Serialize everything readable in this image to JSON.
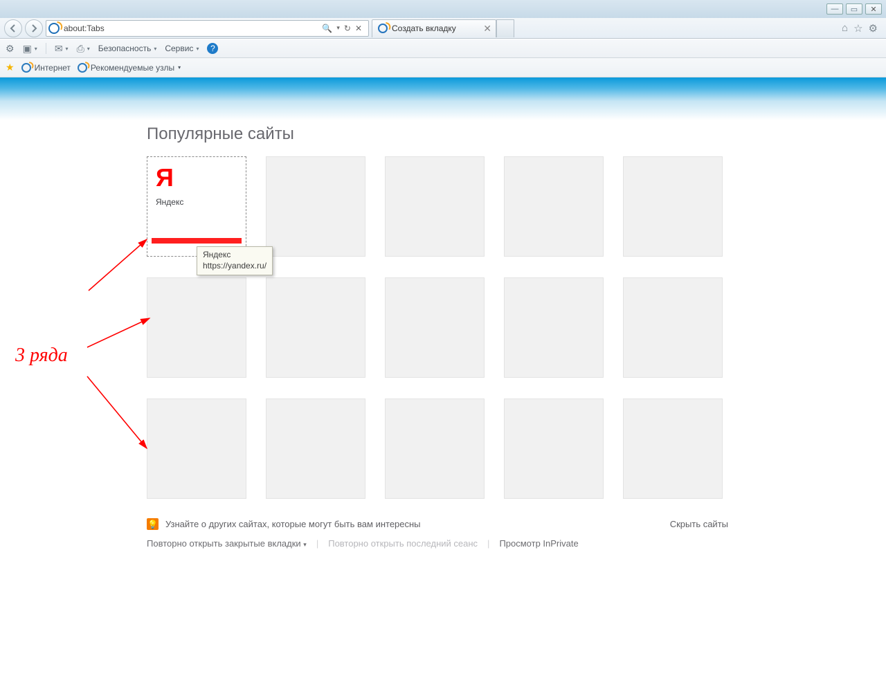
{
  "os": {
    "min_icon": "—",
    "max_icon": "▭",
    "close_icon": "✕"
  },
  "nav": {
    "url": "about:Tabs",
    "search_icon": "🔍",
    "refresh_icon": "↻",
    "stop_icon": "✕"
  },
  "tab": {
    "title": "Создать вкладку",
    "close": "✕"
  },
  "right": {
    "home": "⌂",
    "star": "☆",
    "gear": "⚙"
  },
  "cmdbar": {
    "tools": "⚙",
    "rss": "▣",
    "mail": "✉",
    "print": "⎙",
    "safety": "Безопасность",
    "service": "Сервис",
    "help": "?"
  },
  "favbar": {
    "star": "★",
    "internet": "Интернет",
    "recommended": "Рекомендуемые узлы"
  },
  "page": {
    "heading": "Популярные сайты",
    "tile1": {
      "letter": "Я",
      "name": "Яндекс"
    },
    "tooltip": {
      "title": "Яндекс",
      "url": "https://yandex.ru/"
    },
    "suggest": "Узнайте о других сайтах, которые могут быть вам интересны",
    "hide": "Скрыть сайты",
    "reopen_closed": "Повторно открыть закрытые вкладки",
    "reopen_last": "Повторно открыть последний сеанс",
    "inprivate": "Просмотр InPrivate"
  },
  "anno": {
    "label": "3 ряда"
  }
}
